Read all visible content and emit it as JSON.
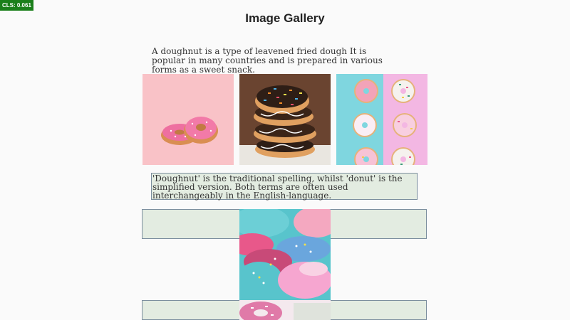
{
  "cls_badge": "CLS: 0.061",
  "title": "Image Gallery",
  "intro": "A doughnut is a type of leavened fried dough It is popular in many countries and is prepared in various forms as a sweet snack.",
  "caption": "'Doughnut' is the traditional spelling, whilst 'donut' is the simplified version. Both terms are often used interchangeably in the English-language."
}
